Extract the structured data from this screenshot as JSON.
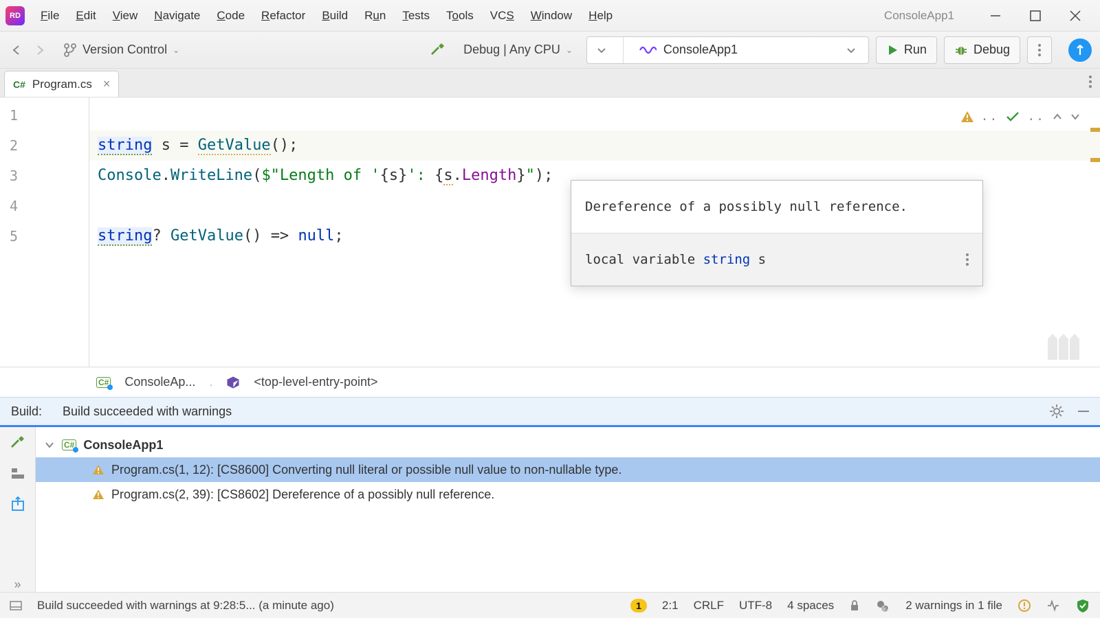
{
  "window": {
    "title": "ConsoleApp1"
  },
  "menu": [
    "File",
    "Edit",
    "View",
    "Navigate",
    "Code",
    "Refactor",
    "Build",
    "Run",
    "Tests",
    "Tools",
    "VCS",
    "Window",
    "Help"
  ],
  "menu_accel": [
    0,
    0,
    0,
    0,
    0,
    0,
    0,
    0,
    0,
    0,
    2,
    0,
    0
  ],
  "toolbar": {
    "vcs": "Version Control",
    "config": "Debug | Any CPU",
    "project": "ConsoleApp1",
    "run": "Run",
    "debug": "Debug"
  },
  "tab": {
    "lang": "C#",
    "name": "Program.cs"
  },
  "editor": {
    "lines": [
      "1",
      "2",
      "3",
      "4",
      "5"
    ]
  },
  "tooltip": {
    "head": "Dereference of a possibly null reference.",
    "body_prefix": "local variable ",
    "body_type": "string",
    "body_suffix": " s"
  },
  "crumbs": {
    "proj": "ConsoleAp...",
    "entry": "<top-level-entry-point>"
  },
  "build": {
    "label": "Build:",
    "status": "Build succeeded with warnings",
    "project": "ConsoleApp1",
    "messages": [
      "Program.cs(1, 12): [CS8600] Converting null literal or possible null value to non-nullable type.",
      "Program.cs(2, 39): [CS8602] Dereference of a possibly null reference."
    ]
  },
  "status": {
    "msg": "Build succeeded with warnings at 9:28:5... (a minute ago)",
    "badge": "1",
    "pos": "2:1",
    "eol": "CRLF",
    "enc": "UTF-8",
    "indent": "4 spaces",
    "inspect": "2 warnings in 1 file"
  }
}
